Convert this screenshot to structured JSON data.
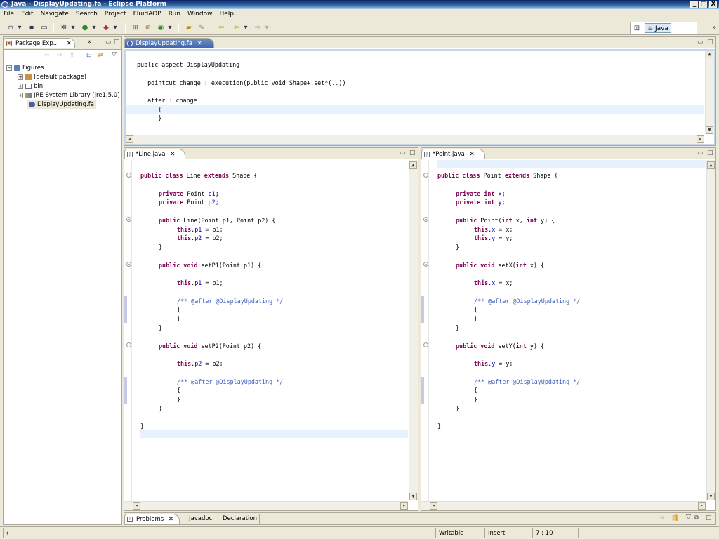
{
  "window": {
    "title": "Java - DisplayUpdating.fa - Eclipse Platform",
    "min": "_",
    "max": "□",
    "close": "X"
  },
  "menu": [
    "File",
    "Edit",
    "Navigate",
    "Search",
    "Project",
    "FluidAOP",
    "Run",
    "Window",
    "Help"
  ],
  "toolbar": {
    "perspective_label": "Java",
    "overflow": "»"
  },
  "package_explorer": {
    "tab_label": "Package Exp...",
    "close": "✕",
    "overflow": "»",
    "tree": [
      {
        "label": "Figures",
        "expander": "−"
      },
      {
        "label": "(default package)",
        "expander": "+"
      },
      {
        "label": "bin",
        "expander": "+"
      },
      {
        "label": "JRE System Library [jre1.5.0]",
        "expander": "+"
      },
      {
        "label": "DisplayUpdating.fa"
      }
    ]
  },
  "aspect_editor": {
    "tab_label": "DisplayUpdating.fa",
    "close": "✕",
    "lines": [
      "public aspect DisplayUpdating",
      "",
      "   pointcut change : execution(public void Shape+.set*(..))",
      "",
      "   after : change",
      "      {",
      "      }"
    ]
  },
  "line_editor": {
    "tab_label": "*Line.java",
    "close": "✕",
    "l_class": [
      "public class",
      " Line ",
      "extends",
      " Shape {"
    ],
    "l_f1": [
      "private",
      " Point ",
      "p1",
      ";"
    ],
    "l_f2": [
      "private",
      " Point ",
      "p2",
      ";"
    ],
    "l_ctor": [
      "public",
      " Line(Point p1, Point p2) {"
    ],
    "l_ctor1": [
      "this",
      ".",
      "p1",
      " = p1;"
    ],
    "l_ctor2": [
      "this",
      ".",
      "p2",
      " = p2;"
    ],
    "l_close": "}",
    "l_m1": [
      "public void",
      " setP1(Point p1) {"
    ],
    "l_m1b": [
      "this",
      ".",
      "p1",
      " = p1;"
    ],
    "l_comment": "/** @after @DisplayUpdating */",
    "l_open_brace": "{",
    "l_m2": [
      "public void",
      " setP2(Point p2) {"
    ],
    "l_m2b": [
      "this",
      ".",
      "p2",
      " = p2;"
    ]
  },
  "point_editor": {
    "tab_label": "*Point.java",
    "close": "✕",
    "p_class": [
      "public class",
      " Point ",
      "extends",
      " Shape {"
    ],
    "p_f1": [
      "private int",
      " ",
      "x",
      ";"
    ],
    "p_f2": [
      "private int",
      " ",
      "y",
      ";"
    ],
    "p_ctor": [
      "public",
      " Point(",
      "int",
      " x, ",
      "int",
      " y) {"
    ],
    "p_ctor1": [
      "this",
      ".",
      "x",
      " = x;"
    ],
    "p_ctor2": [
      "this",
      ".",
      "y",
      " = y;"
    ],
    "p_m1": [
      "public void",
      " setX(",
      "int",
      " x) {"
    ],
    "p_m1b": [
      "this",
      ".",
      "x",
      " = x;"
    ],
    "p_m2": [
      "public void",
      " setY(",
      "int",
      " y) {"
    ],
    "p_m2b": [
      "this",
      ".",
      "y",
      " = y;"
    ]
  },
  "bottom_tabs": {
    "problems": "Problems",
    "problems_close": "✕",
    "javadoc": "Javadoc",
    "declaration": "Declaration"
  },
  "status": {
    "writable": "Writable",
    "insert": "Insert",
    "position": "7 : 10"
  }
}
